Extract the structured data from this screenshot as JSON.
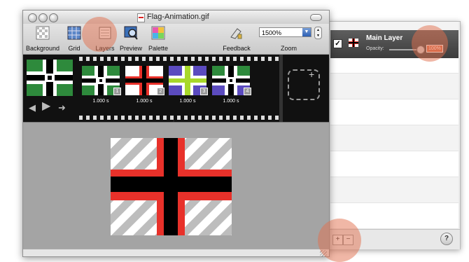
{
  "window": {
    "title": "Flag-Animation.gif"
  },
  "toolbar": {
    "background_label": "Background",
    "grid_label": "Grid",
    "layers_label": "Layers",
    "preview_label": "Preview",
    "palette_label": "Palette",
    "feedback_label": "Feedback",
    "zoom_label": "Zoom",
    "zoom_value": "1500%"
  },
  "frames": [
    {
      "number": "1",
      "duration": "1.000 s"
    },
    {
      "number": "2",
      "duration": "1.000 s"
    },
    {
      "number": "3",
      "duration": "1.000 s"
    },
    {
      "number": "4",
      "duration": "1.000 s"
    }
  ],
  "layers_panel": {
    "layer_name": "Main Layer",
    "opacity_label": "Opacity:",
    "opacity_value": "100%",
    "add_symbol": "+",
    "remove_symbol": "−",
    "help_symbol": "?"
  },
  "controls": {
    "check": "✓",
    "prev": "◀",
    "play": "▶",
    "next": "➜",
    "plus": "+"
  },
  "colors": {
    "highlight": "#e2704e",
    "flag_red": "#e8312a",
    "flag_black": "#000000",
    "frame_green": "#2e8a3c",
    "frame_purple": "#5b4bbf",
    "frame_lime": "#a8d82a"
  },
  "icons": [
    "background-icon",
    "grid-icon",
    "layers-icon",
    "preview-icon",
    "palette-icon",
    "feedback-icon"
  ]
}
